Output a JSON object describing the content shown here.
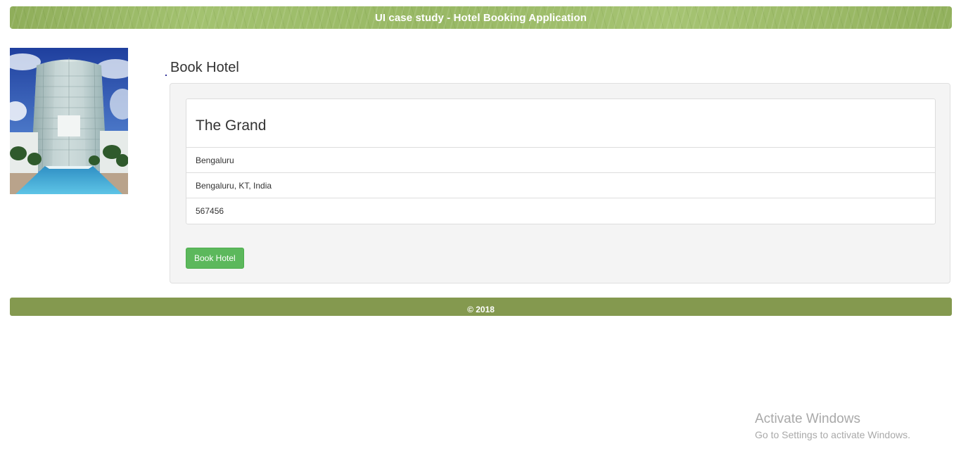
{
  "header": {
    "title": "UI case study - Hotel Booking Application"
  },
  "hotel_image": {
    "alt": "hotel-photo"
  },
  "main": {
    "title": "Book Hotel",
    "hotel": {
      "name": "The Grand",
      "city": "Bengaluru",
      "address": "Bengaluru, KT, India",
      "pincode": "567456"
    },
    "book_button_label": "Book Hotel"
  },
  "footer": {
    "text": "© 2018"
  },
  "watermark": {
    "title": "Activate Windows",
    "subtitle": "Go to Settings to activate Windows."
  },
  "colors": {
    "header_green": "#9ab866",
    "footer_green": "#84994f",
    "button_green": "#5cb85c",
    "panel_bg": "#f4f4f4"
  }
}
